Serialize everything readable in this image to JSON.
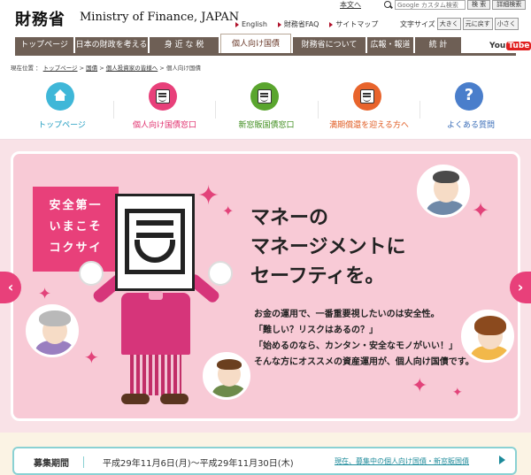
{
  "header": {
    "logo_ja": "財務省",
    "logo_en": "Ministry of Finance, JAPAN",
    "skip_link": "本文へ",
    "search_placeholder": "Google カスタム検索",
    "search_button": "検 索",
    "help_link": "詳細検索",
    "util_links": [
      "English",
      "財務省FAQ",
      "サイトマップ"
    ],
    "font_size_label": "文字サイズ",
    "font_size_buttons": [
      "大きく",
      "元に戻す",
      "小さく"
    ]
  },
  "gnav": {
    "items": [
      "トップページ",
      "日本の財政を考える",
      "身 近 な 税",
      "個人向け国債",
      "財務省について",
      "広報・報道",
      "統 計"
    ],
    "youtube_you": "You",
    "youtube_tube": "Tube"
  },
  "breadcrumb": {
    "prefix": "現在位置 ：",
    "items": [
      "トップページ",
      "国債",
      "個人投資家の皆様へ",
      "個人向け国債"
    ]
  },
  "category_menu": {
    "items": [
      {
        "label": "トップページ",
        "color": "#3fb7d8",
        "icon": "home-icon"
      },
      {
        "label": "個人向け国債窓口",
        "color": "#e8407a",
        "icon": "mascot-face-icon"
      },
      {
        "label": "新窓販国債窓口",
        "color": "#5aa52e",
        "icon": "mascot-face-icon"
      },
      {
        "label": "満期償還を迎える方へ",
        "color": "#e8642c",
        "icon": "mascot-face-icon"
      },
      {
        "label": "よくある質問",
        "color": "#4a7ecb",
        "icon": "question-icon"
      }
    ]
  },
  "hero": {
    "slogan": [
      "安全第一",
      "いまこそ",
      "コクサイ"
    ],
    "headline": [
      "マネーの",
      "マネージメントに",
      "セーフティを。"
    ],
    "body": [
      "お金の運用で、一番重要視したいのは安全性。",
      "「難しい？リスクはあるの？」",
      "「始めるのなら、カンタン・安全なモノがいい！」",
      "そんな方にオススメの資産運用が、個人向け国債です。"
    ],
    "accent_color": "#e8407a"
  },
  "period": {
    "label": "募集期間",
    "dates": "平成29年11月6日(月)〜平成29年11月30日(木)",
    "link": "現在、募集中の個人向け国債・新窓販国債"
  }
}
